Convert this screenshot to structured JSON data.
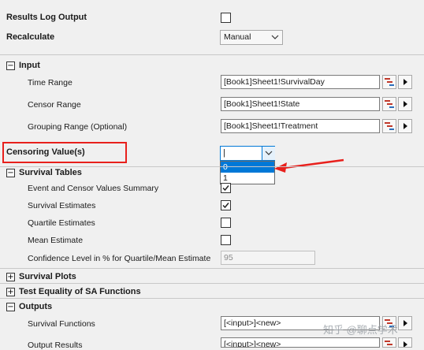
{
  "colors": {
    "highlight_box": "#e8201c",
    "arrow": "#e8201c",
    "selection": "#0078d7"
  },
  "top": {
    "results_log_label": "Results Log Output",
    "results_log_checked": false,
    "recalculate_label": "Recalculate",
    "recalculate_value": "Manual"
  },
  "input": {
    "section_label": "Input",
    "expander": "−",
    "time_range_label": "Time Range",
    "time_range_value": "[Book1]Sheet1!SurvivalDay",
    "censor_range_label": "Censor Range",
    "censor_range_value": "[Book1]Sheet1!State",
    "grouping_range_label": "Grouping Range (Optional)",
    "grouping_range_value": "[Book1]Sheet1!Treatment"
  },
  "censoring": {
    "label": "Censoring Value(s)",
    "current": "|",
    "options": [
      "0",
      "1"
    ],
    "selected_index": 0
  },
  "survival_tables": {
    "section_label": "Survival Tables",
    "expander": "−",
    "items": [
      {
        "label": "Event and Censor Values Summary",
        "checked": true
      },
      {
        "label": "Survival Estimates",
        "checked": true
      },
      {
        "label": "Quartile Estimates",
        "checked": false
      },
      {
        "label": "Mean Estimate",
        "checked": false
      }
    ],
    "confidence_label": "Confidence Level in % for Quartile/Mean Estimate",
    "confidence_value": "95"
  },
  "survival_plots": {
    "section_label": "Survival Plots",
    "expander": "+"
  },
  "test_equality": {
    "section_label": "Test Equality of SA Functions",
    "expander": "+"
  },
  "outputs": {
    "section_label": "Outputs",
    "expander": "−",
    "survival_functions_label": "Survival Functions",
    "survival_functions_value": "[<input>]<new>",
    "output_results_label": "Output Results",
    "output_results_value": "[<input>]<new>"
  },
  "watermark": "知乎 @聊点学术"
}
